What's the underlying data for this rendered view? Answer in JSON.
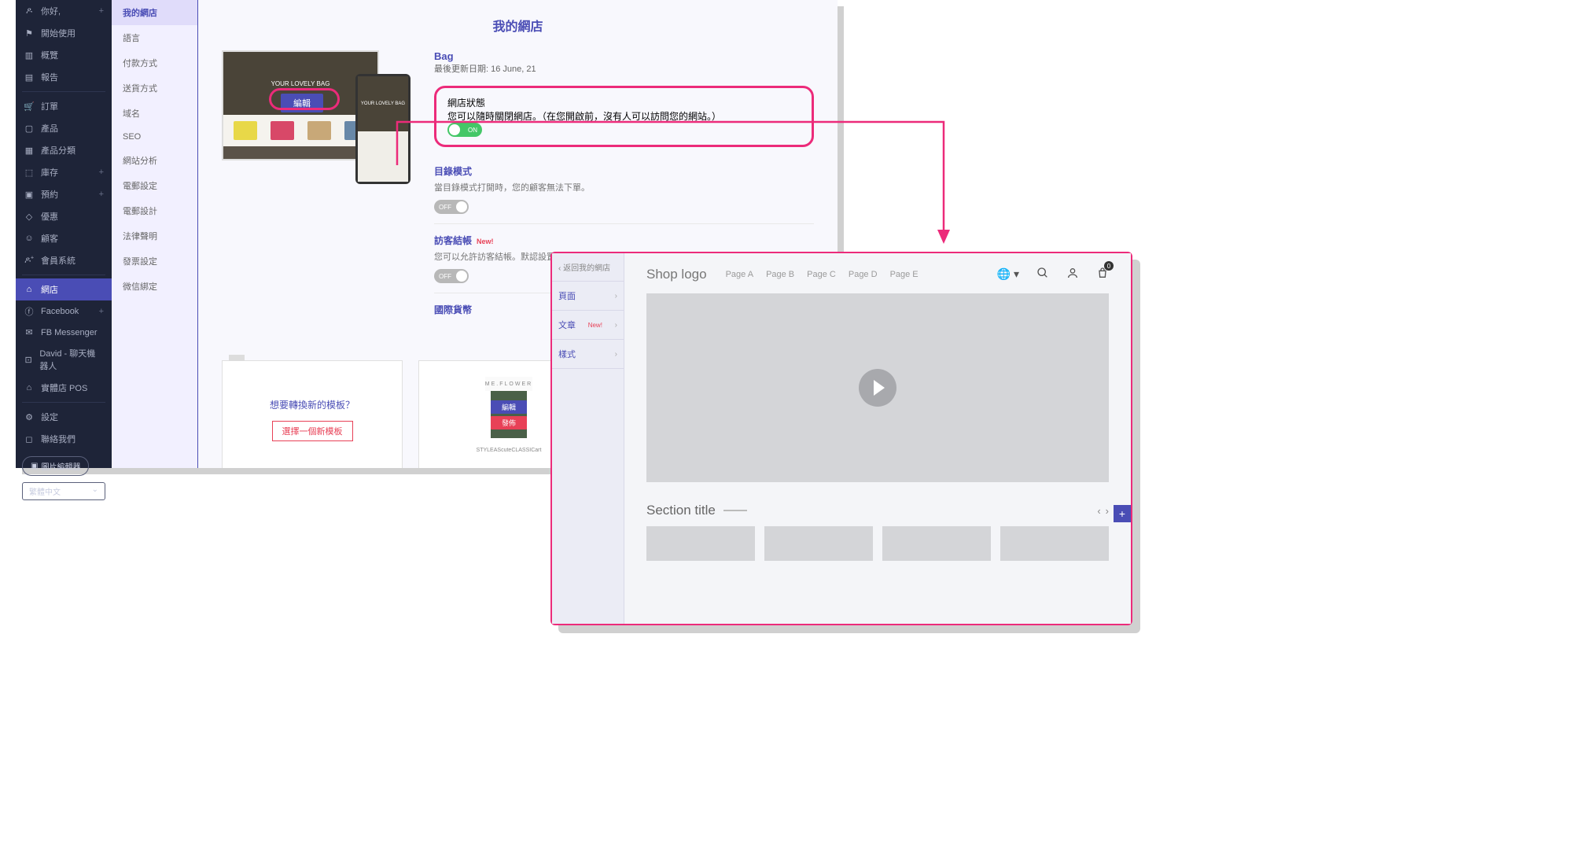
{
  "darkSidebar": {
    "items": [
      {
        "icon": "user",
        "label": "你好,",
        "plus": true
      },
      {
        "icon": "flag",
        "label": "開始使用"
      },
      {
        "icon": "bar",
        "label": "概覽"
      },
      {
        "icon": "doc",
        "label": "報告"
      },
      {
        "sep": true
      },
      {
        "icon": "cart",
        "label": "訂單"
      },
      {
        "icon": "tag",
        "label": "產品"
      },
      {
        "icon": "grid",
        "label": "產品分類"
      },
      {
        "icon": "box",
        "label": "庫存",
        "plus": true
      },
      {
        "icon": "cal",
        "label": "預約",
        "plus": true
      },
      {
        "icon": "ticket",
        "label": "優惠"
      },
      {
        "icon": "face",
        "label": "顧客"
      },
      {
        "icon": "users",
        "label": "會員系統"
      },
      {
        "sep": true
      },
      {
        "icon": "store",
        "label": "網店",
        "active": true
      },
      {
        "icon": "fb",
        "label": "Facebook",
        "plus": true
      },
      {
        "icon": "msg",
        "label": "FB Messenger"
      },
      {
        "icon": "bot",
        "label": "David - 聊天機器人"
      },
      {
        "icon": "shop",
        "label": "實體店 POS"
      },
      {
        "sep": true
      },
      {
        "icon": "gear",
        "label": "設定"
      },
      {
        "icon": "chat",
        "label": "聯絡我們"
      }
    ],
    "imageEditor": "圖片編輯器",
    "language": "繁體中文"
  },
  "subSidebar": {
    "items": [
      {
        "label": "我的網店",
        "active": true
      },
      {
        "label": "語言"
      },
      {
        "label": "付款方式"
      },
      {
        "label": "送貨方式"
      },
      {
        "label": "域名"
      },
      {
        "label": "SEO"
      },
      {
        "label": "網站分析"
      },
      {
        "label": "電郵設定"
      },
      {
        "label": "電郵設計"
      },
      {
        "label": "法律聲明"
      },
      {
        "label": "發票設定"
      },
      {
        "label": "微信綁定"
      }
    ]
  },
  "main": {
    "title": "我的網店",
    "preview": {
      "heroTagline": "YOUR LOVELY BAG",
      "editBtn": "編輯"
    },
    "shop": {
      "name": "Bag",
      "dateLabel": "最後更新日期:",
      "date": "16 June, 21"
    },
    "settings": {
      "status": {
        "title": "網店狀態",
        "desc": "您可以隨時關閉網店。（在您開啟前，沒有人可以訪問您的網站。）",
        "toggle": "ON"
      },
      "catalog": {
        "title": "目錄模式",
        "desc": "當目錄模式打開時，您的顧客無法下單。",
        "toggle": "OFF"
      },
      "guest": {
        "title": "訪客結帳",
        "new": "New!",
        "desc": "您可以允許訪客結帳。默認設置為關閉。",
        "toggle": "OFF"
      },
      "currency": {
        "title": "國際貨幣"
      }
    },
    "templates": {
      "question": "想要轉換新的模板？",
      "chooseBtn": "選擇一個新模板",
      "previewBrand": "ME.FLOWER",
      "previewEdit": "編輯",
      "previewPublish": "發佈",
      "brandLogos": [
        "STYLE",
        "AS",
        "cute",
        "CLASSIC",
        "art"
      ]
    }
  },
  "editor": {
    "back": "‹ 返回我的網店",
    "items": [
      {
        "label": "頁面",
        "chev": "›"
      },
      {
        "label": "文章",
        "new": "New!",
        "chev": "›"
      },
      {
        "label": "樣式",
        "chev": "›"
      }
    ],
    "header": {
      "logo": "Shop logo",
      "pages": [
        "Page A",
        "Page B",
        "Page C",
        "Page D",
        "Page E"
      ],
      "cartCount": "0"
    },
    "sectionTitle": "Section title",
    "addBtn": "+"
  }
}
